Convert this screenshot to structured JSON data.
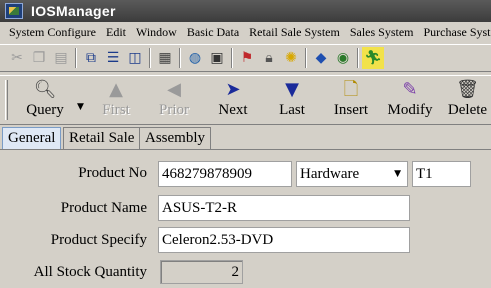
{
  "window": {
    "title": "IOSManager"
  },
  "menu": [
    "System Configure",
    "Edit",
    "Window",
    "Basic Data",
    "Retail Sale System",
    "Sales System",
    "Purchase System"
  ],
  "toolbar": {
    "icons": [
      "cut-icon",
      "copy-icon",
      "paste-icon",
      "cascade-icon",
      "tile-horizontal-icon",
      "tile-vertical-icon",
      "calculator-icon",
      "globe-icon",
      "report-icon",
      "flag-icon",
      "lock-icon",
      "lightbulb-icon",
      "diamond-icon",
      "disc-icon",
      "exit-person-icon"
    ]
  },
  "actions": {
    "query": "Query",
    "first": "First",
    "prior": "Prior",
    "next": "Next",
    "last": "Last",
    "insert": "Insert",
    "modify": "Modify",
    "delete": "Delete"
  },
  "tabs": [
    "General",
    "Retail Sale",
    "Assembly"
  ],
  "form": {
    "product_no_label": "Product No",
    "product_no": "468279878909",
    "category": "Hardware",
    "code": "T1",
    "product_name_label": "Product Name",
    "product_name": "ASUS-T2-R",
    "product_specify_label": "Product Specify",
    "product_specify": "Celeron2.53-DVD",
    "stock_label": "All Stock Quantity",
    "stock_quantity": "2"
  }
}
